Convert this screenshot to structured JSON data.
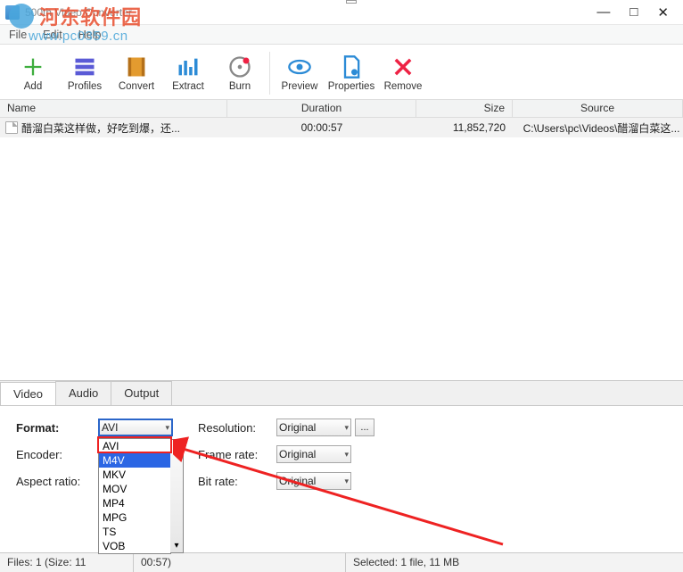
{
  "window": {
    "title": "500th Video Converter",
    "controls": {
      "min": "—",
      "max": "□",
      "close": "✕"
    }
  },
  "watermark": {
    "text": "河东软件园",
    "url": "www.pc0359.cn"
  },
  "menu": {
    "file": "File",
    "edit": "Edit",
    "help": "Help"
  },
  "toolbar": {
    "add": "Add",
    "profiles": "Profiles",
    "convert": "Convert",
    "extract": "Extract",
    "burn": "Burn",
    "preview": "Preview",
    "properties": "Properties",
    "remove": "Remove"
  },
  "columns": {
    "name": "Name",
    "duration": "Duration",
    "size": "Size",
    "source": "Source"
  },
  "file": {
    "name": "醋溜白菜这样做，好吃到爆，还...",
    "duration": "00:00:57",
    "size": "11,852,720",
    "source": "C:\\Users\\pc\\Videos\\醋溜白菜这..."
  },
  "tabs": {
    "video": "Video",
    "audio": "Audio",
    "output": "Output"
  },
  "form": {
    "format_label": "Format:",
    "format_value": "AVI",
    "encoder_label": "Encoder:",
    "aspect_label": "Aspect ratio:",
    "resolution_label": "Resolution:",
    "resolution_value": "Original",
    "framerate_label": "Frame rate:",
    "framerate_value": "Original",
    "bitrate_label": "Bit rate:",
    "bitrate_value": "Original",
    "ellipsis": "..."
  },
  "dropdown": {
    "items": [
      "AVI",
      "M4V",
      "MKV",
      "MOV",
      "MP4",
      "MPG",
      "TS",
      "VOB"
    ],
    "selected": "M4V"
  },
  "status": {
    "files": "Files: 1 (Size: 11",
    "mid": "00:57)",
    "selected": "Selected: 1 file, 11 MB"
  }
}
